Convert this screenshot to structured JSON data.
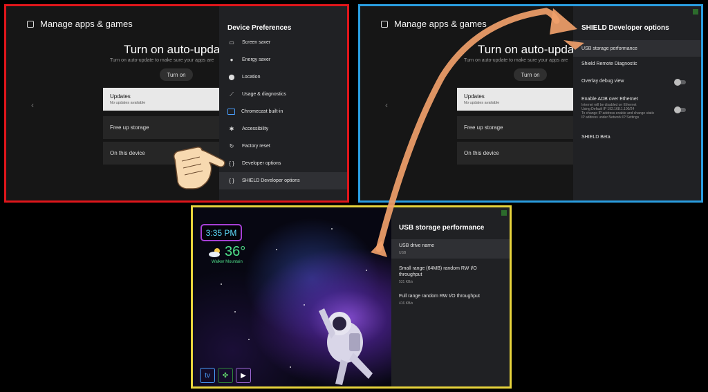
{
  "screens": {
    "device_preferences": {
      "app_title": "Manage apps & games",
      "heading": "Turn on auto-updates",
      "subtitle": "Turn on auto-update to make sure your apps are",
      "turn_on_label": "Turn on",
      "cards": [
        {
          "label": "Updates",
          "sub": "No updates available"
        },
        {
          "label": "Free up storage",
          "sub": ""
        },
        {
          "label": "On this device",
          "sub": ""
        }
      ],
      "menu_title": "Device Preferences",
      "menu_items": [
        {
          "label": "Screen saver",
          "icon": "screen-saver-icon"
        },
        {
          "label": "Energy saver",
          "icon": "bulb-icon"
        },
        {
          "label": "Location",
          "icon": "location-pin-icon"
        },
        {
          "label": "Usage & diagnostics",
          "icon": "chart-icon"
        },
        {
          "label": "Chromecast built-in",
          "icon": "cast-icon"
        },
        {
          "label": "Accessibility",
          "icon": "accessibility-icon"
        },
        {
          "label": "Factory reset",
          "icon": "reset-icon"
        },
        {
          "label": "Developer options",
          "icon": "braces-icon"
        },
        {
          "label": "SHIELD Developer options",
          "icon": "braces-icon"
        }
      ]
    },
    "shield_dev": {
      "app_title": "Manage apps & games",
      "heading": "Turn on auto-updates",
      "subtitle": "Turn on auto-update to make sure your apps are",
      "turn_on_label": "Turn on",
      "cards": [
        {
          "label": "Updates",
          "sub": "No updates available"
        },
        {
          "label": "Free up storage",
          "sub": ""
        },
        {
          "label": "On this device",
          "sub": ""
        }
      ],
      "menu_title": "SHIELD Developer options",
      "items": {
        "usb": "USB storage performance",
        "remote": "Shield Remote Diagnostic",
        "overlay": "Overlay debug view",
        "adb": "Enable ADB over Ethernet",
        "adb_note1": "Internet will be disabled on Ethernet",
        "adb_note2": "Using Default IP 192.168.1.100/24",
        "adb_note3": "To change IP address enable and change static",
        "adb_note4": "IP address under Network IP Settings",
        "beta": "SHIELD Beta"
      },
      "toggles": {
        "overlay": false,
        "adb": false
      }
    },
    "usb_perf": {
      "clock": "3:35 PM",
      "temperature": "36°",
      "location": "Walker Mountain",
      "panel_title": "USB storage performance",
      "items": [
        {
          "label": "USB drive name",
          "value": "USB"
        },
        {
          "label": "Small range (64MB) random RW I/O throughput",
          "value": "531 KB/s"
        },
        {
          "label": "Full range random RW I/O throughput",
          "value": "416 KB/s"
        }
      ],
      "dock_icons": [
        "tv-icon",
        "leaf-icon",
        "play-icon"
      ]
    }
  },
  "colors": {
    "border1": "#e0161b",
    "border2": "#2a9de0",
    "border3": "#e8d43c",
    "arrow": "#f0a06a"
  }
}
